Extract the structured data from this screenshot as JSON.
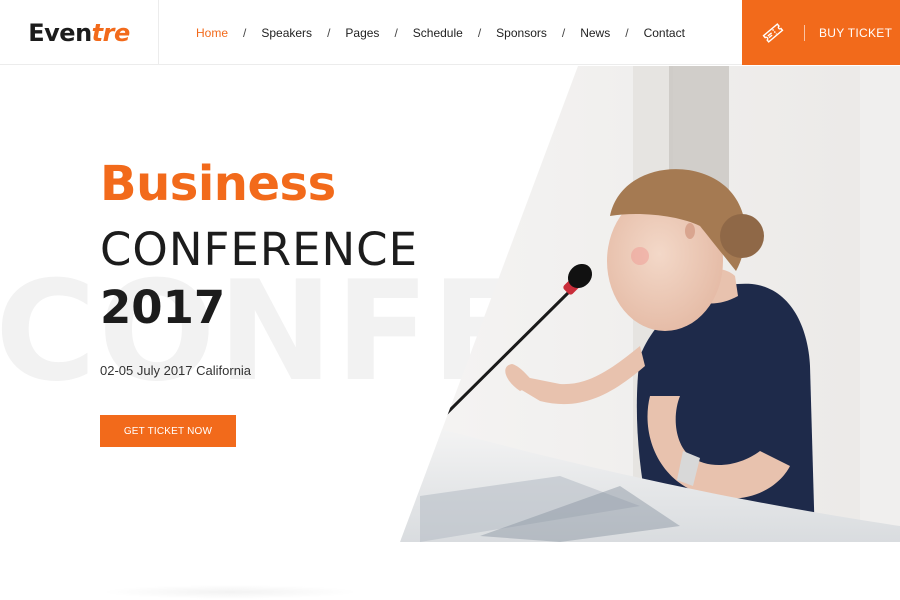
{
  "logo": {
    "part1": "Even",
    "part2": "tre"
  },
  "nav": {
    "items": [
      {
        "label": "Home",
        "active": true
      },
      {
        "label": "Speakers"
      },
      {
        "label": "Pages"
      },
      {
        "label": "Schedule"
      },
      {
        "label": "Sponsors"
      },
      {
        "label": "News"
      },
      {
        "label": "Contact"
      }
    ],
    "separator": "/"
  },
  "header": {
    "buy_ticket_label": "BUY TICKET",
    "icon": "ticket-icon"
  },
  "hero": {
    "title_line1": "Business",
    "title_line2": "CONFERENCE",
    "title_line3": "2017",
    "watermark": "CONFERENC",
    "date_location": "02-05 July 2017 California",
    "cta_label": "GET TICKET NOW"
  },
  "colors": {
    "accent": "#f26a1b",
    "dark_text": "#1c1c1c",
    "speaker_top": "#1e2a4a"
  }
}
